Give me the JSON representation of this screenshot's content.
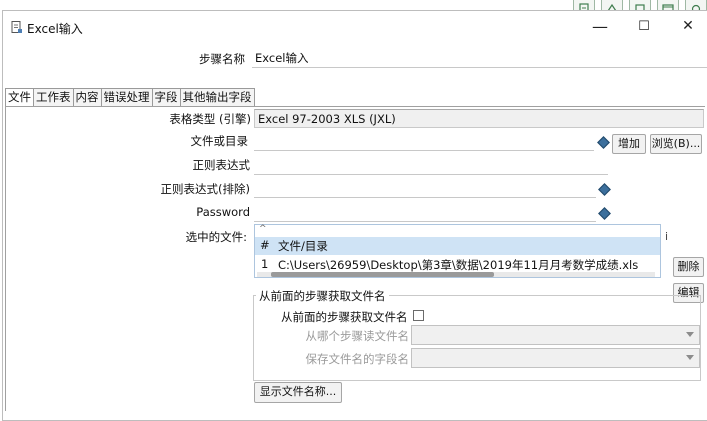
{
  "window": {
    "title": "Excel输入",
    "minimize": "—",
    "maximize": "☐",
    "close": "✕"
  },
  "step_name": {
    "label": "步骤名称",
    "value": "Excel输入"
  },
  "tabs": [
    {
      "label": "文件"
    },
    {
      "label": "工作表"
    },
    {
      "label": "内容"
    },
    {
      "label": "错误处理"
    },
    {
      "label": "字段"
    },
    {
      "label": "其他输出字段"
    }
  ],
  "file_tab": {
    "spreadsheet_type": {
      "label": "表格类型 (引擎)",
      "value": "Excel 97-2003 XLS (JXL)"
    },
    "file_or_dir": {
      "label": "文件或目录",
      "value": "",
      "add_button": "增加",
      "browse_button": "浏览(B)..."
    },
    "regex": {
      "label": "正则表达式",
      "value": ""
    },
    "regex_exclude": {
      "label": "正则表达式(排除)",
      "value": ""
    },
    "password": {
      "label": "Password",
      "value": ""
    },
    "selected_files": {
      "label": "选中的文件:",
      "columns": [
        "#",
        "文件/目录"
      ],
      "rows": [
        {
          "num": "1",
          "path": "C:\\Users\\26959\\Desktop\\第3章\\数据\\2019年11月月考数学成绩.xls"
        }
      ],
      "delete_button": "删除",
      "edit_button": "编辑"
    },
    "from_previous": {
      "group_title": "从前面的步骤获取文件名",
      "checkbox_label": "从前面的步骤获取文件名",
      "checked": false,
      "read_from_step": {
        "label": "从哪个步骤读文件名",
        "value": ""
      },
      "field_name": {
        "label": "保存文件名的字段名",
        "value": ""
      }
    },
    "show_filenames_button": "显示文件名称..."
  }
}
